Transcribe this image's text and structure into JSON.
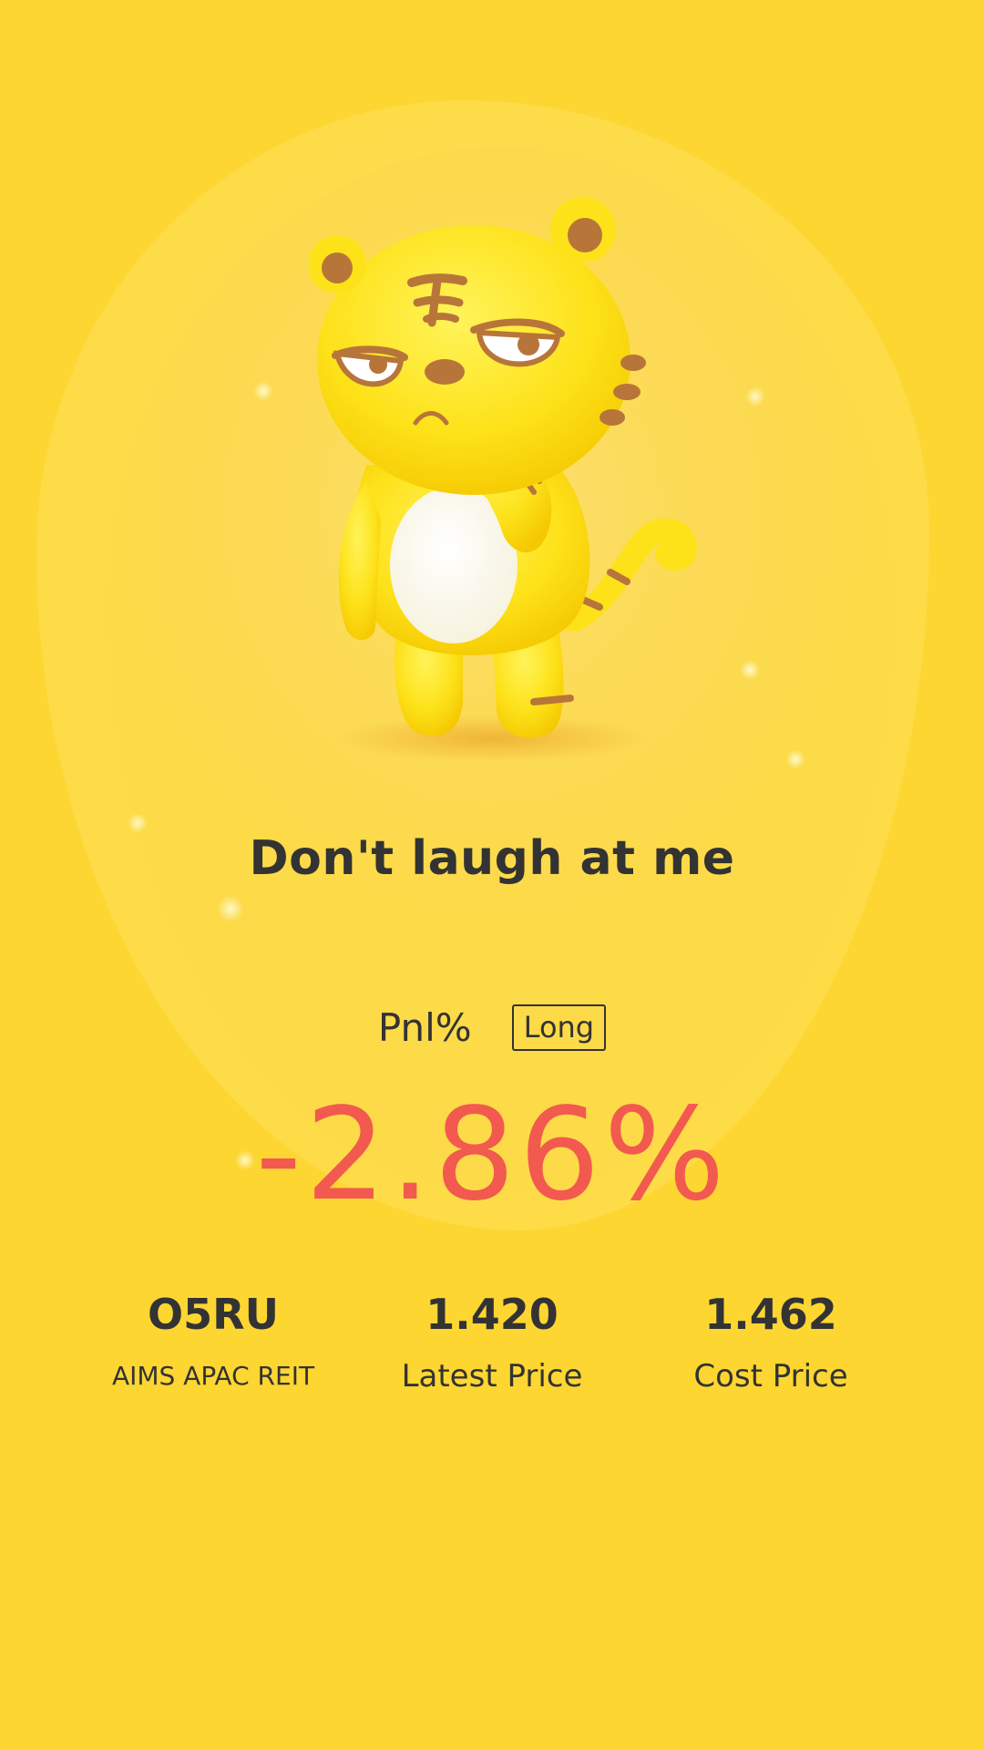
{
  "mood": {
    "title": "Don't laugh at me",
    "mascot_icon": "tiger-mascot-icon"
  },
  "pnl": {
    "label": "Pnl%",
    "direction": "Long",
    "value": "-2.86%",
    "value_color": "#f25a4f"
  },
  "stock": {
    "code": "O5RU",
    "name": "AIMS APAC REIT"
  },
  "latest_price": {
    "value": "1.420",
    "label": "Latest Price"
  },
  "cost_price": {
    "value": "1.462",
    "label": "Cost Price"
  },
  "theme": {
    "background": "#fdd535",
    "text": "#333333"
  }
}
